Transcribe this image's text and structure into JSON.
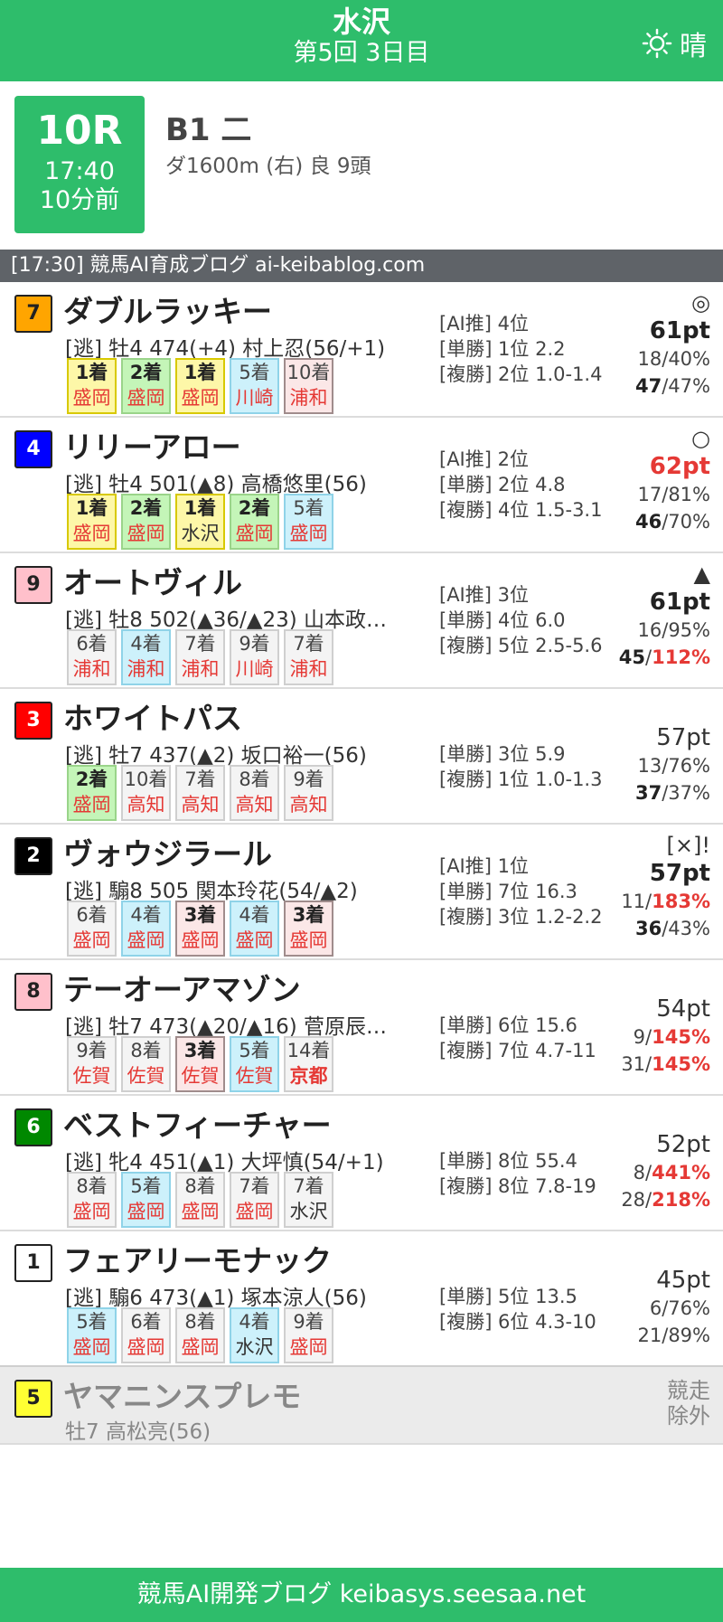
{
  "header": {
    "venue": "水沢",
    "session": "第5回 3日目",
    "weather_icon": "sun-icon",
    "weather": "晴"
  },
  "race": {
    "number": "10R",
    "time": "17:40",
    "countdown": "10分前",
    "class": "B1 二",
    "conditions": "ダ1600m (右) 良 9頭"
  },
  "notice": "[17:30] 競馬AI育成ブログ ai-keibablog.com",
  "horses": [
    {
      "waku": "7",
      "name": "ダブルラッキー",
      "info": "[逃] 牡4 474(+4) 村上忍(56/+1)",
      "past": [
        {
          "fin": "1着",
          "track": "盛岡"
        },
        {
          "fin": "2着",
          "track": "盛岡"
        },
        {
          "fin": "1着",
          "track": "盛岡"
        },
        {
          "fin": "5着",
          "track": "川崎"
        },
        {
          "fin": "10着",
          "track": "浦和"
        }
      ],
      "ai": "[AI推] 4位",
      "win": "[単勝] 1位 2.2",
      "place": "[複勝] 2位 1.0-1.4",
      "mark": "◎",
      "pts": "61pt",
      "rate1": "18/40%",
      "rate2_n": "47",
      "rate2_p": "/47%"
    },
    {
      "waku": "4",
      "name": "リリーアロー",
      "info": "[逃] 牡4 501(▲8) 高橋悠里(56)",
      "past": [
        {
          "fin": "1着",
          "track": "盛岡"
        },
        {
          "fin": "2着",
          "track": "盛岡"
        },
        {
          "fin": "1着",
          "track": "水沢"
        },
        {
          "fin": "2着",
          "track": "盛岡"
        },
        {
          "fin": "5着",
          "track": "盛岡"
        }
      ],
      "ai": "[AI推] 2位",
      "win": "[単勝] 2位 4.8",
      "place": "[複勝] 4位 1.5-3.1",
      "mark": "○",
      "pts": "62pt",
      "rate1": "17/81%",
      "rate2_n": "46",
      "rate2_p": "/70%"
    },
    {
      "waku": "9",
      "name": "オートヴィル",
      "info": "[逃] 牡8 502(▲36/▲23) 山本政…",
      "past": [
        {
          "fin": "6着",
          "track": "浦和"
        },
        {
          "fin": "4着",
          "track": "浦和"
        },
        {
          "fin": "7着",
          "track": "浦和"
        },
        {
          "fin": "9着",
          "track": "川崎"
        },
        {
          "fin": "7着",
          "track": "浦和"
        }
      ],
      "ai": "[AI推] 3位",
      "win": "[単勝] 4位 6.0",
      "place": "[複勝] 5位 2.5-5.6",
      "mark": "▲",
      "pts": "61pt",
      "rate1": "16/95%",
      "rate2_n": "45",
      "rate2_p": "/",
      "rate2_red": "112%"
    },
    {
      "waku": "3",
      "name": "ホワイトパス",
      "info": "[逃] 牡7 437(▲2) 坂口裕一(56)",
      "past": [
        {
          "fin": "2着",
          "track": "盛岡"
        },
        {
          "fin": "10着",
          "track": "高知"
        },
        {
          "fin": "7着",
          "track": "高知"
        },
        {
          "fin": "8着",
          "track": "高知"
        },
        {
          "fin": "9着",
          "track": "高知"
        }
      ],
      "win": "[単勝] 3位 5.9",
      "place": "[複勝] 1位 1.0-1.3",
      "pts": "57pt",
      "rate1": "13/76%",
      "rate2_n": "37",
      "rate2_p": "/37%"
    },
    {
      "waku": "2",
      "name": "ヴォウジラール",
      "info": "[逃] 騸8 505 関本玲花(54/▲2)",
      "past": [
        {
          "fin": "6着",
          "track": "盛岡"
        },
        {
          "fin": "4着",
          "track": "盛岡"
        },
        {
          "fin": "3着",
          "track": "盛岡"
        },
        {
          "fin": "4着",
          "track": "盛岡"
        },
        {
          "fin": "3着",
          "track": "盛岡"
        }
      ],
      "ai": "[AI推] 1位",
      "win": "[単勝] 7位 16.3",
      "place": "[複勝] 3位 1.2-2.2",
      "mark": "[×]!",
      "pts": "57pt",
      "rate1_n": "11/",
      "rate1_red": "183%",
      "rate2_n": "36",
      "rate2_p": "/43%"
    },
    {
      "waku": "8",
      "name": "テーオーアマゾン",
      "info": "[逃] 牡7 473(▲20/▲16) 菅原辰…",
      "past": [
        {
          "fin": "9着",
          "track": "佐賀"
        },
        {
          "fin": "8着",
          "track": "佐賀"
        },
        {
          "fin": "3着",
          "track": "佐賀"
        },
        {
          "fin": "5着",
          "track": "佐賀"
        },
        {
          "fin": "14着",
          "track": "京都"
        }
      ],
      "win": "[単勝] 6位 15.6",
      "place": "[複勝] 7位 4.7-11",
      "pts": "54pt",
      "rate1_n": "9/",
      "rate1_red": "145%",
      "rate2_plain": "31/",
      "rate2_red": "145%"
    },
    {
      "waku": "6",
      "name": "ベストフィーチャー",
      "info": "[逃] 牝4 451(▲1) 大坪慎(54/+1)",
      "past": [
        {
          "fin": "8着",
          "track": "盛岡"
        },
        {
          "fin": "5着",
          "track": "盛岡"
        },
        {
          "fin": "8着",
          "track": "盛岡"
        },
        {
          "fin": "7着",
          "track": "盛岡"
        },
        {
          "fin": "7着",
          "track": "水沢"
        }
      ],
      "win": "[単勝] 8位 55.4",
      "place": "[複勝] 8位 7.8-19",
      "pts": "52pt",
      "rate1_n": "8/",
      "rate1_red": "441%",
      "rate2_plain": "28/",
      "rate2_red": "218%"
    },
    {
      "waku": "1",
      "name": "フェアリーモナック",
      "info": "[逃] 騸6 473(▲1) 塚本涼人(56)",
      "past": [
        {
          "fin": "5着",
          "track": "盛岡"
        },
        {
          "fin": "6着",
          "track": "盛岡"
        },
        {
          "fin": "8着",
          "track": "盛岡"
        },
        {
          "fin": "4着",
          "track": "水沢"
        },
        {
          "fin": "9着",
          "track": "盛岡"
        }
      ],
      "win": "[単勝] 5位 13.5",
      "place": "[複勝] 6位 4.3-10",
      "pts": "45pt",
      "rate1": "6/76%",
      "rate2_plain": "21/89%"
    }
  ],
  "scratched": {
    "waku": "5",
    "name": "ヤマニンスプレモ",
    "info": "牡7 高松亮(56)",
    "label1": "競走",
    "label2": "除外"
  },
  "footer": "競馬AI開発ブログ keibasys.seesaa.net",
  "colors": {
    "brand_green": "#2ebd6b",
    "waku1": "#ffffff",
    "waku2": "#000000",
    "waku3": "#ff0000",
    "waku4": "#0000ff",
    "waku5": "#ffff33",
    "waku6": "#008800",
    "waku7": "#ffa500",
    "waku8": "#ffc0cb",
    "waku9": "#ffc0cb"
  }
}
